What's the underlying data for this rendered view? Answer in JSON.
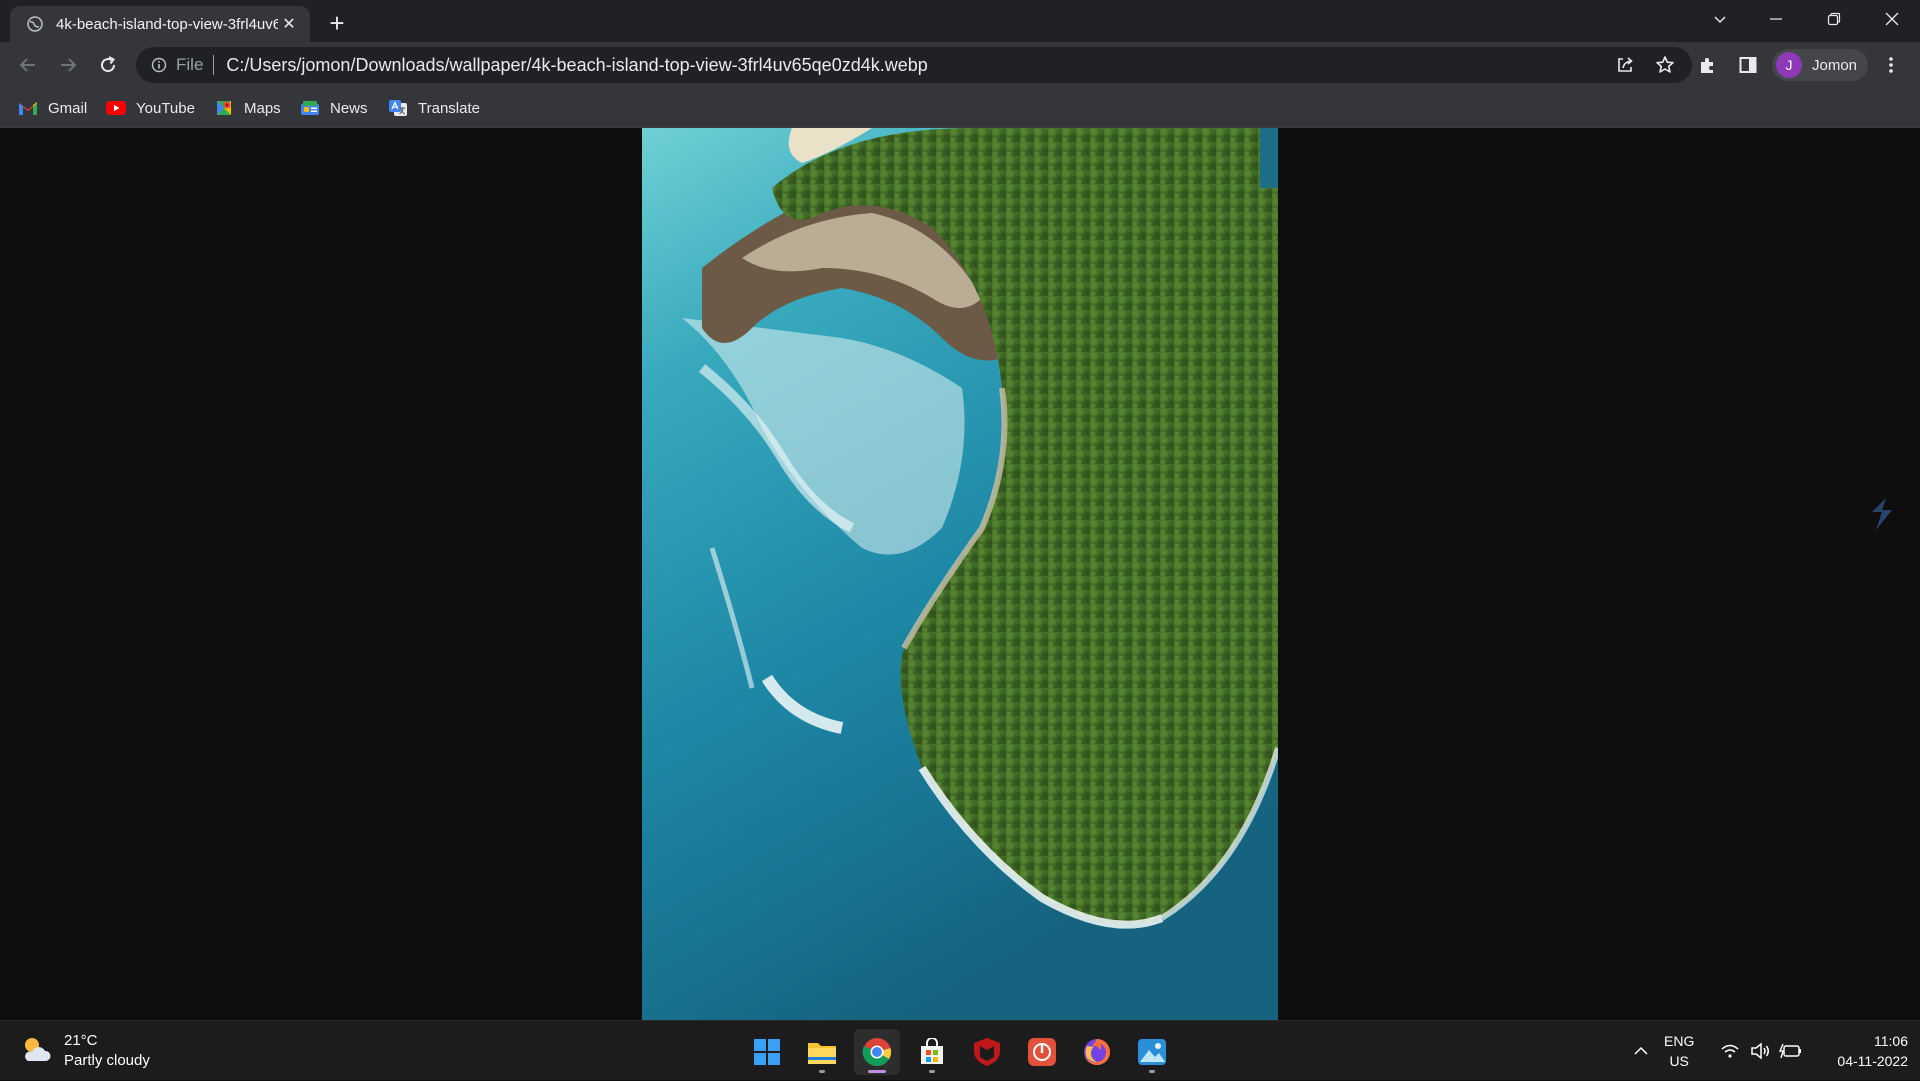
{
  "browser": {
    "tab": {
      "title": "4k-beach-island-top-view-3frl4uv65qe0zd4k.webp",
      "close": "✕"
    },
    "new_tab": "+",
    "address": {
      "scheme": "File",
      "url": "C:/Users/jomon/Downloads/wallpaper/4k-beach-island-top-view-3frl4uv65qe0zd4k.webp"
    },
    "profile": {
      "initial": "J",
      "name": "Jomon"
    },
    "bookmarks": [
      {
        "label": "Gmail",
        "icon": "gmail-icon"
      },
      {
        "label": "YouTube",
        "icon": "youtube-icon"
      },
      {
        "label": "Maps",
        "icon": "maps-icon"
      },
      {
        "label": "News",
        "icon": "news-icon"
      },
      {
        "label": "Translate",
        "icon": "translate-icon"
      }
    ]
  },
  "taskbar": {
    "weather": {
      "temp": "21°C",
      "condition": "Partly cloudy"
    },
    "language": {
      "line1": "ENG",
      "line2": "US"
    },
    "clock": {
      "time": "11:06",
      "date": "04-11-2022"
    }
  }
}
